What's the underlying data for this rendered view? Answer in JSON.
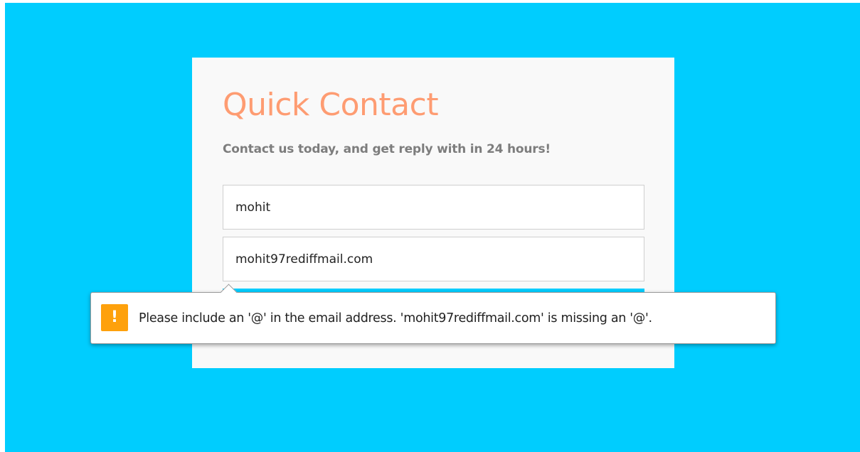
{
  "contact": {
    "title": "Quick Contact",
    "subtitle": "Contact us today, and get reply with in 24 hours!",
    "name_value": "mohit",
    "email_value": "mohit97rediffmail.com"
  },
  "validation": {
    "icon_glyph": "!",
    "message": "Please include an '@' in the email address. 'mohit97rediffmail.com' is missing an '@'."
  },
  "colors": {
    "background": "#00cdfe",
    "card": "#f9f9f9",
    "title": "#fe9c72",
    "subtitle": "#7d7d7d",
    "warning_icon": "#fea10c"
  }
}
